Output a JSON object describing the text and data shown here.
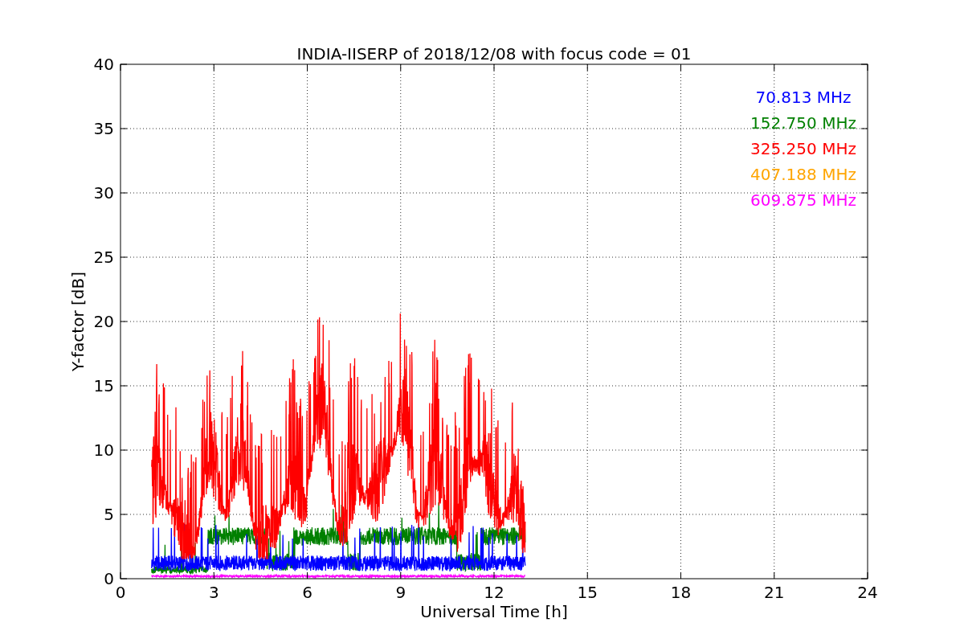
{
  "plot": {
    "title": "INDIA-IISERP of 2018/12/08 with focus code = 01",
    "xlabel": "Universal Time [h]",
    "ylabel": "Y-factor [dB]",
    "xticks": [
      "0",
      "3",
      "6",
      "9",
      "12",
      "15",
      "18",
      "21",
      "24"
    ],
    "yticks": [
      "40",
      "35",
      "30",
      "25",
      "20",
      "15",
      "10",
      "5",
      "0"
    ],
    "legend": [
      {
        "label": "70.813 MHz",
        "color": "#0000ff"
      },
      {
        "label": "152.750 MHz",
        "color": "#008000"
      },
      {
        "label": "325.250 MHz",
        "color": "#ff0000"
      },
      {
        "label": "407.188 MHz",
        "color": "#ffa500"
      },
      {
        "label": "609.875 MHz",
        "color": "#ff00ff"
      }
    ]
  }
}
